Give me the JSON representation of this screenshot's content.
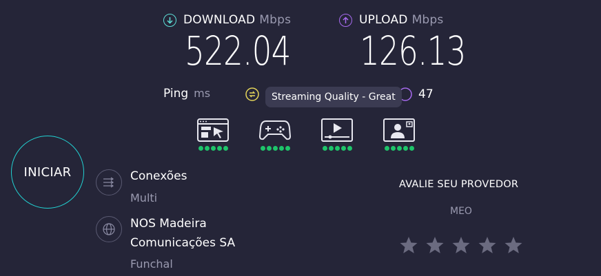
{
  "download": {
    "label": "DOWNLOAD",
    "unit": "Mbps",
    "value": "522.04",
    "icon": "download-arrow-icon",
    "color": "#5ee1d9"
  },
  "upload": {
    "label": "UPLOAD",
    "unit": "Mbps",
    "value": "126.13",
    "icon": "upload-arrow-icon",
    "color": "#a86bf0"
  },
  "ping": {
    "label": "Ping",
    "unit": "ms",
    "jitter_icon": "jitter-icon",
    "jitter_color": "#e6d65a",
    "upload_latency": "47",
    "upload_latency_color": "#a86bf0"
  },
  "tooltip": {
    "text": "Streaming Quality - Great"
  },
  "streaming": {
    "items": [
      {
        "icon": "web-browsing-icon",
        "rating": 5,
        "max": 5
      },
      {
        "icon": "gaming-controller-icon",
        "rating": 5,
        "max": 5
      },
      {
        "icon": "video-streaming-icon",
        "rating": 5,
        "max": 5
      },
      {
        "icon": "video-call-icon",
        "rating": 5,
        "max": 5
      }
    ],
    "dot_color": "#1ec46a"
  },
  "go_button": {
    "label": "INICIAR",
    "ring_color": "#22d3d3"
  },
  "connections": {
    "title": "Conexões",
    "value": "Multi",
    "icon": "connections-arrows-icon"
  },
  "isp": {
    "name_line1": "NOS Madeira",
    "name_line2": "Comunicações SA",
    "location": "Funchal",
    "icon": "globe-icon"
  },
  "rate_provider": {
    "title": "AVALIE SEU PROVEDOR",
    "provider": "MEO",
    "stars_total": 5,
    "stars_selected": 0
  }
}
